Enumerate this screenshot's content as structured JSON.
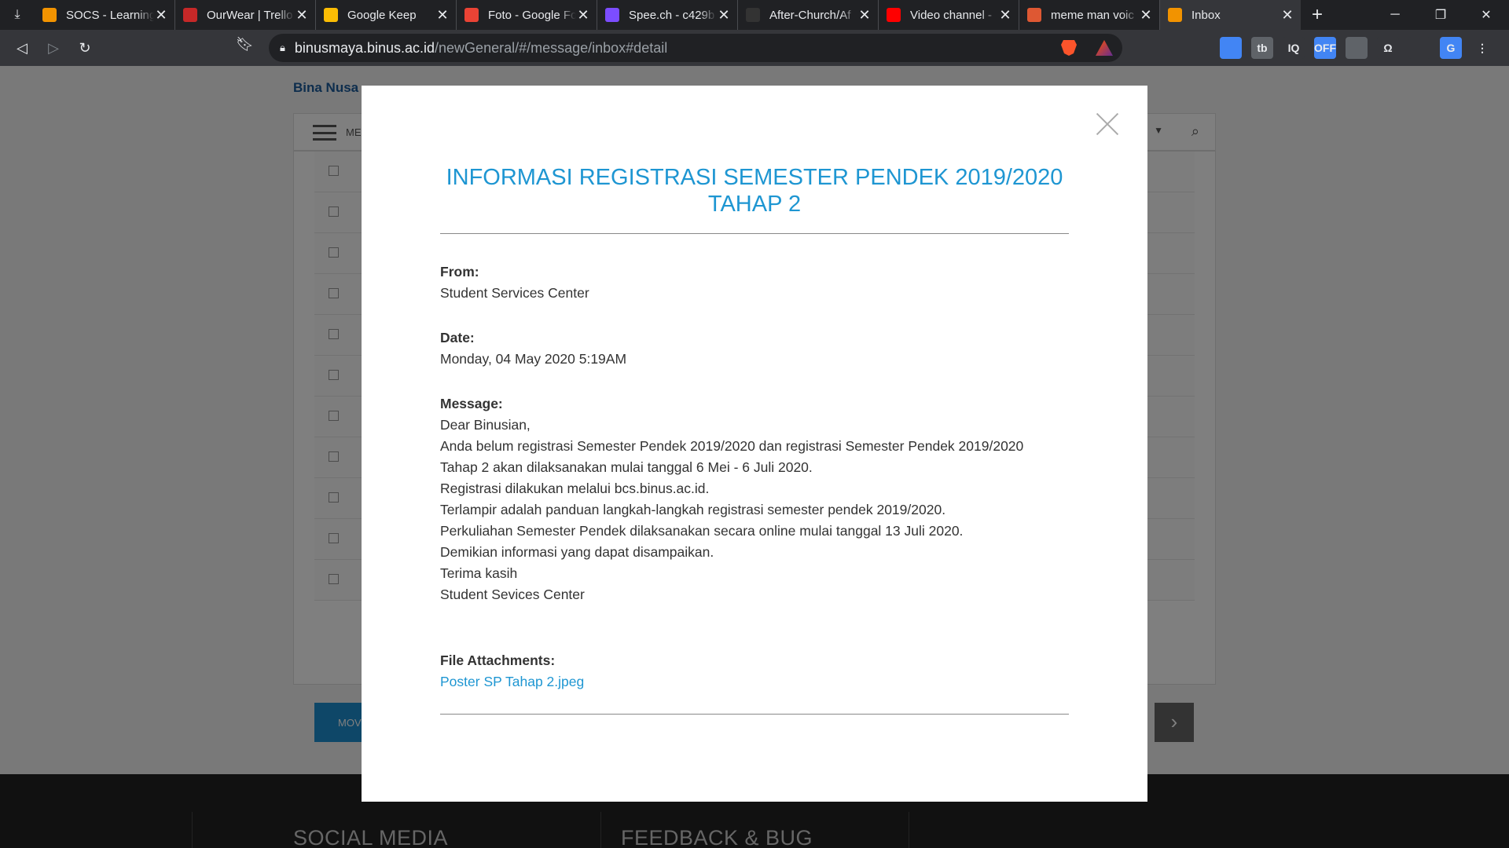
{
  "browser": {
    "tabs": [
      {
        "title": "SOCS - Learning",
        "favicon_color": "#f29300",
        "favicon_icon": "eye-icon"
      },
      {
        "title": "OurWear | Trello",
        "favicon_color": "#c62828",
        "favicon_icon": "trello-icon"
      },
      {
        "title": "Google Keep",
        "favicon_color": "#fbbc04",
        "favicon_icon": "keep-icon"
      },
      {
        "title": "Foto - Google Fo",
        "favicon_color": "#ea4335",
        "favicon_icon": "photos-icon"
      },
      {
        "title": "Spee.ch - c429b",
        "favicon_color": "#7c4dff",
        "favicon_icon": "speech-icon"
      },
      {
        "title": "After-Church/Af",
        "favicon_color": "#333333",
        "favicon_icon": "github-icon"
      },
      {
        "title": "Video channel -",
        "favicon_color": "#ff0000",
        "favicon_icon": "youtube-icon"
      },
      {
        "title": "meme man voic",
        "favicon_color": "#de5833",
        "favicon_icon": "duckduckgo-icon"
      },
      {
        "title": "Inbox",
        "favicon_color": "#f29300",
        "favicon_icon": "eye-icon",
        "active": true
      }
    ],
    "url_host": "binusmaya.binus.ac.id",
    "url_path": "/newGeneral/#/message/inbox#detail",
    "extensions": [
      {
        "name": "ext-1",
        "label": "",
        "color": "#4285f4"
      },
      {
        "name": "ext-tb",
        "label": "tb",
        "color": "#5f6368"
      },
      {
        "name": "ext-iq",
        "label": "IQ",
        "color": "#35363a"
      },
      {
        "name": "ext-off",
        "label": "OFF",
        "color": "#4285f4"
      },
      {
        "name": "ext-bulb",
        "label": "",
        "color": "#5f6368"
      },
      {
        "name": "ext-omega",
        "label": "Ω",
        "color": "#35363a"
      },
      {
        "name": "ext-check",
        "label": "",
        "color": "#35363a"
      },
      {
        "name": "ext-translate",
        "label": "G",
        "color": "#4285f4"
      }
    ]
  },
  "background_page": {
    "brand": "Bina Nusa",
    "menu_label": "ME",
    "move_button": "MOV",
    "footer": {
      "social": "SOCIAL MEDIA",
      "feedback": "FEEDBACK & BUG"
    }
  },
  "modal": {
    "title": "INFORMASI REGISTRASI SEMESTER PENDEK 2019/2020 TAHAP 2",
    "from_label": "From:",
    "from_value": "Student Services Center",
    "date_label": "Date:",
    "date_value": "Monday, 04 May 2020 5:19AM",
    "message_label": "Message:",
    "message_lines": [
      "Dear Binusian,",
      "Anda belum registrasi Semester Pendek 2019/2020 dan registrasi Semester Pendek 2019/2020",
      "Tahap 2 akan dilaksanakan mulai tanggal 6 Mei - 6 Juli 2020.",
      "Registrasi dilakukan melalui bcs.binus.ac.id.",
      "Terlampir adalah panduan langkah-langkah registrasi semester pendek 2019/2020.",
      "Perkuliahan Semester Pendek dilaksanakan secara online mulai tanggal 13 Juli 2020.",
      "Demikian informasi yang dapat disampaikan.",
      "Terima kasih",
      "Student Sevices Center"
    ],
    "attachments_label": "File Attachments:",
    "attachment_name": "Poster SP Tahap 2.jpeg",
    "accent_color": "#1e96d2"
  }
}
